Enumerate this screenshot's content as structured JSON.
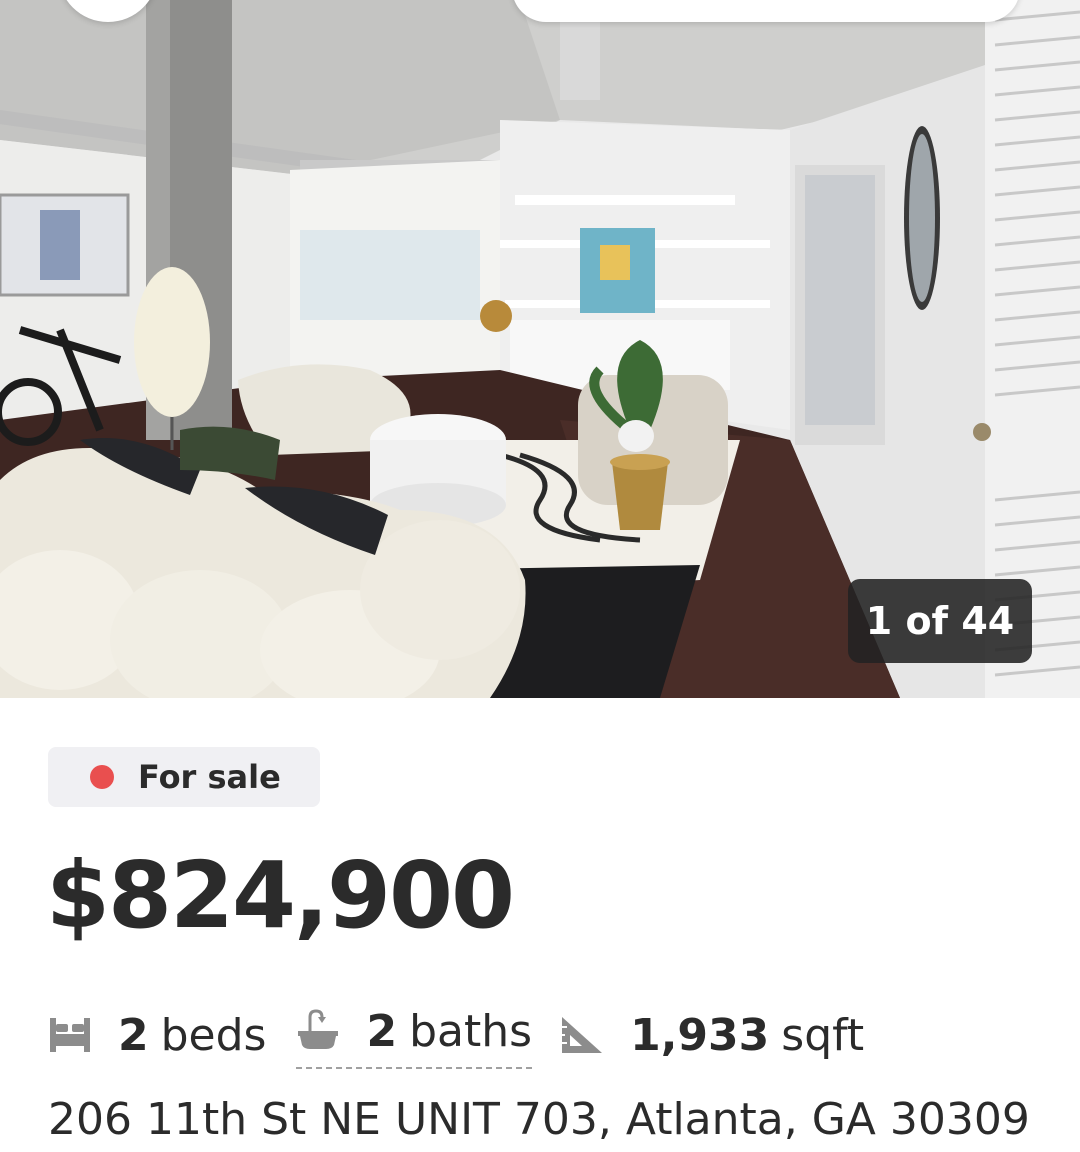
{
  "photo": {
    "counter_current": "1",
    "counter_of": "of",
    "counter_total": "44",
    "counter_text": "1 of 44"
  },
  "listing": {
    "status": "For sale",
    "status_color": "#e94f4f",
    "price": "$824,900",
    "beds_value": "2",
    "beds_unit": "beds",
    "baths_value": "2",
    "baths_unit": "baths",
    "sqft_value": "1,933",
    "sqft_unit": "sqft",
    "address": "206 11th St NE UNIT 703, Atlanta, GA 30309"
  },
  "icons": {
    "beds": "bed-icon",
    "baths": "bathtub-icon",
    "sqft": "ruler-triangle-icon"
  }
}
